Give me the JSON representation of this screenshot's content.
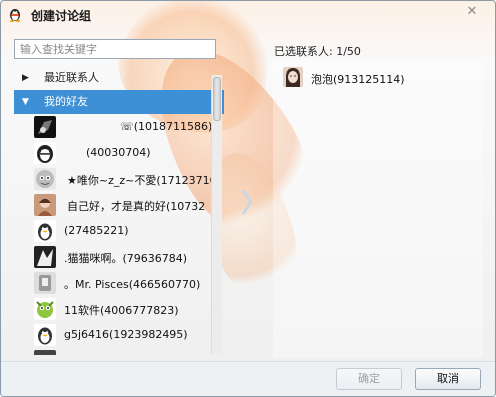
{
  "window": {
    "title": "创建讨论组",
    "close_label": "✕"
  },
  "search": {
    "placeholder": "输入查找关键字"
  },
  "groups": [
    {
      "label": "最近联系人",
      "expanded": false
    },
    {
      "label": "我的好友",
      "expanded": true
    }
  ],
  "contacts": [
    "☏(1018711586)",
    "(40030704)",
    "★唯你~z_z~不愛(17123710",
    "自己好，才是真的好(10732",
    "(27485221)",
    ".猫猫咪啊。(79636784)",
    "。Mr. Pisces(466560770)",
    "11软件(4006777823)",
    "g5j6416(1923982495)"
  ],
  "selected": {
    "label": "已选联系人: 1/50",
    "items": [
      {
        "name": "泡泡(913125114)"
      }
    ]
  },
  "buttons": {
    "ok": "确定",
    "cancel": "取消"
  },
  "colors": {
    "selection": "#3d8fd6",
    "accent_arrow": "#c6d8e8"
  }
}
